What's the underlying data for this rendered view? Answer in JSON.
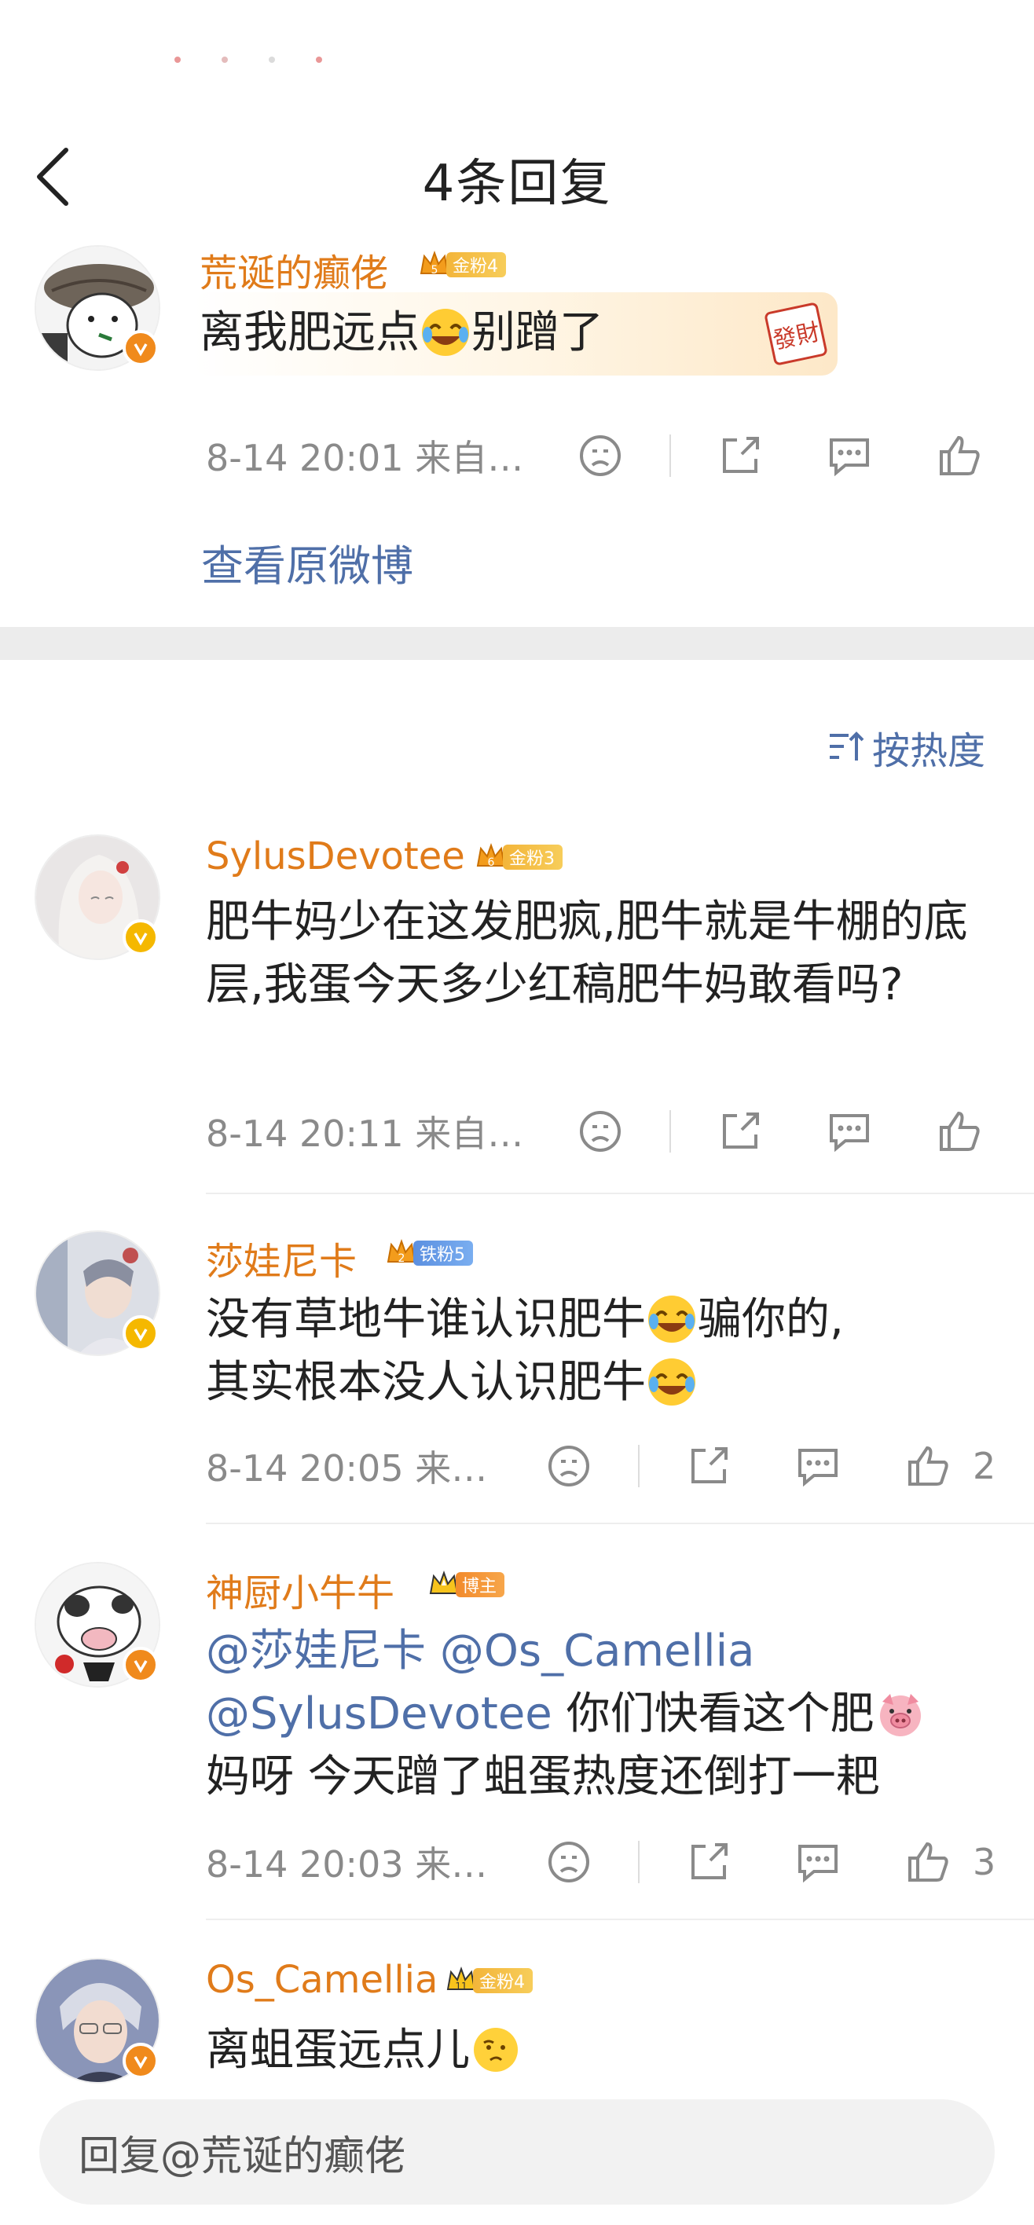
{
  "header": {
    "title": "4条回复"
  },
  "root_comment": {
    "username": "荒诞的癫佬",
    "badge_level": "5",
    "badge_label": "金粉4",
    "text_before_emoji": "离我肥远点",
    "text_after_emoji": "别蹭了",
    "time": "8-14 20:01",
    "source": "来自…",
    "view_original": "查看原微博"
  },
  "sort": {
    "label": "按热度"
  },
  "comments": [
    {
      "username": "SylusDevotee",
      "badge_level": "6",
      "badge_label": "金粉3",
      "text": "肥牛妈少在这发肥疯,肥牛就是牛棚的底层,我蛋今天多少红稿肥牛妈敢看吗?",
      "time": "8-14 20:11",
      "source": "来自…",
      "likes": ""
    },
    {
      "username": "莎娃尼卡",
      "badge_level": "2",
      "badge_label": "铁粉5",
      "text_line1_before": "没有草地牛谁认识肥牛",
      "text_line1_after": "骗你的,",
      "text_line2_before": "其实根本没人认识肥牛",
      "time": "8-14 20:05",
      "source": "来…",
      "likes": "2"
    },
    {
      "username": "神厨小牛牛",
      "badge_label": "博主",
      "mention1": "@莎娃尼卡",
      "mention2": "@Os_Camellia",
      "mention3": "@SylusDevotee",
      "text_after_mentions": " 你们快看这个肥",
      "text_line3": "妈呀 今天蹭了蛆蛋热度还倒打一耙",
      "time": "8-14 20:03",
      "source": "来…",
      "likes": "3"
    },
    {
      "username": "Os_Camellia",
      "badge_level": "11",
      "badge_label": "金粉4",
      "text": "离蛆蛋远点儿"
    }
  ],
  "reply_input": {
    "placeholder": "回复@荒诞的癫佬"
  },
  "sticker_text": "發財",
  "colors": {
    "username": "#e07b1a",
    "link": "#4f6fa8",
    "meta": "#8a8a8a"
  }
}
